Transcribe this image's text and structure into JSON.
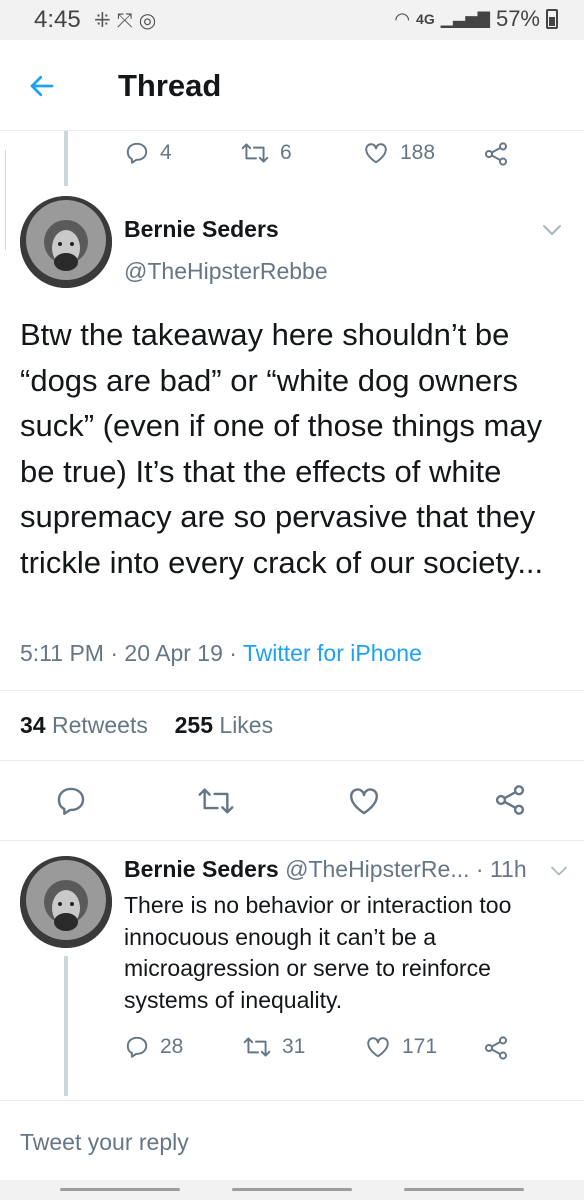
{
  "status_bar": {
    "time": "4:45",
    "left_icons": [
      "slack-icon",
      "missed-call-icon",
      "instagram-icon"
    ],
    "network": "4G",
    "battery": "57%"
  },
  "app_bar": {
    "title": "Thread"
  },
  "parent_actions": {
    "replies": "4",
    "retweets": "6",
    "likes": "188"
  },
  "main_tweet": {
    "name": "Bernie Seders",
    "handle": "@TheHipsterRebbe",
    "text": "Btw the takeaway here shouldn’t be “dogs are bad” or “white dog owners suck” (even if one of those things may be true) It’s that the effects of white supremacy are so pervasive that they trickle into every crack of our society...",
    "time": "5:11 PM",
    "date": "20 Apr 19",
    "client": "Twitter for iPhone",
    "retweet_count": "34",
    "retweet_label": "Retweets",
    "like_count": "255",
    "like_label": "Likes"
  },
  "reply_tweet": {
    "name": "Bernie Seders",
    "handle": "@TheHipsterRe...",
    "time": "11h",
    "text": "There is no behavior or interaction too innocuous enough it can’t be a microagression or serve to reinforce systems of inequality.",
    "replies": "28",
    "retweets": "31",
    "likes": "171"
  },
  "composer": {
    "placeholder": "Tweet your reply"
  },
  "colors": {
    "accent": "#1da1f2",
    "text": "#14171a",
    "secondary": "#657786",
    "divider": "#e6ecf0"
  }
}
